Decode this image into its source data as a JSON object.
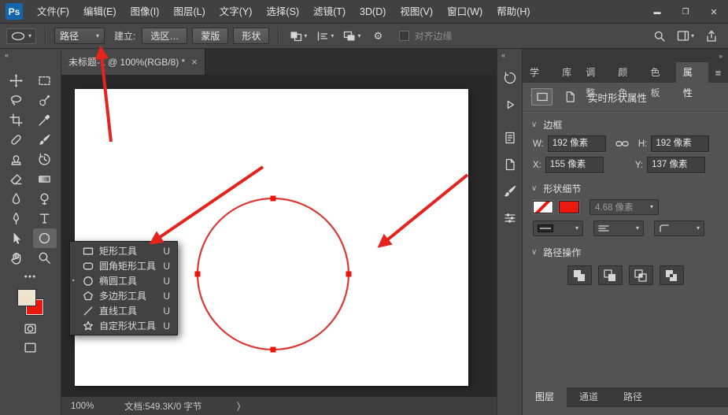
{
  "colors": {
    "accent_red": "#e3231c",
    "circle_stroke": "#db3832",
    "anchor_fill": "#e8150d",
    "foreground_swatch": "#eee3cd",
    "background_swatch": "#ea1910"
  },
  "icons": {
    "ps_logo": "Ps",
    "minimize": "▬",
    "restore": "❐",
    "close": "✕",
    "collapse_left": "«",
    "collapse_right": "»",
    "dropdown_arrow": "▾",
    "section_chevron": "∨",
    "panel_menu": "≡",
    "gear": "⚙",
    "tab_close": "×",
    "ellipsis": "●●●",
    "status_chevron": "❭",
    "current_tool_marker": "▪"
  },
  "titlebar": {
    "menus": [
      "文件(F)",
      "编辑(E)",
      "图像(I)",
      "图层(L)",
      "文字(Y)",
      "选择(S)",
      "滤镜(T)",
      "3D(D)",
      "视图(V)",
      "窗口(W)",
      "帮助(H)"
    ]
  },
  "options_bar": {
    "tool_mode_value": "路径",
    "make_label": "建立:",
    "selection_button": "选区…",
    "mask_button": "蒙版",
    "shape_button": "形状",
    "align_edges_label": "对齐边缘"
  },
  "toolbar": {
    "tools": [
      "move-tool",
      "rectangular-marquee-tool",
      "lasso-tool",
      "quick-selection-tool",
      "crop-tool",
      "eyedropper-tool",
      "spot-healing-brush-tool",
      "brush-tool",
      "clone-stamp-tool",
      "history-brush-tool",
      "eraser-tool",
      "gradient-tool",
      "blur-tool",
      "dodge-tool",
      "pen-tool",
      "type-tool",
      "path-selection-tool",
      "ellipse-tool",
      "hand-tool",
      "zoom-tool"
    ],
    "active_tool": "ellipse-tool"
  },
  "document": {
    "tab_title": "未标题-1 @ 100%(RGB/8) *",
    "zoom_level": "100%",
    "doc_info": "文档:549.3K/0 字节"
  },
  "tool_flyout": {
    "items": [
      {
        "label": "矩形工具",
        "shortcut": "U"
      },
      {
        "label": "圆角矩形工具",
        "shortcut": "U"
      },
      {
        "label": "椭圆工具",
        "shortcut": "U"
      },
      {
        "label": "多边形工具",
        "shortcut": "U"
      },
      {
        "label": "直线工具",
        "shortcut": "U"
      },
      {
        "label": "自定形状工具",
        "shortcut": "U"
      }
    ],
    "active_item": "椭圆工具"
  },
  "right_panel": {
    "tabs": [
      "学习",
      "库",
      "调整",
      "颜色",
      "色板",
      "属性"
    ],
    "active_tab": "属性",
    "panel_title": "实时形状属性",
    "transform": {
      "section_title": "边框",
      "w_label": "W:",
      "w_value": "192 像素",
      "h_label": "H:",
      "h_value": "192 像素",
      "x_label": "X:",
      "x_value": "155 像素",
      "y_label": "Y:",
      "y_value": "137 像素"
    },
    "shape_details": {
      "section_title": "形状细节",
      "stroke_width_value": "4.68 像素"
    },
    "path_operations": {
      "section_title": "路径操作"
    },
    "bottom_tabs": [
      "图层",
      "通道",
      "路径"
    ],
    "active_bottom_tab": "图层"
  }
}
